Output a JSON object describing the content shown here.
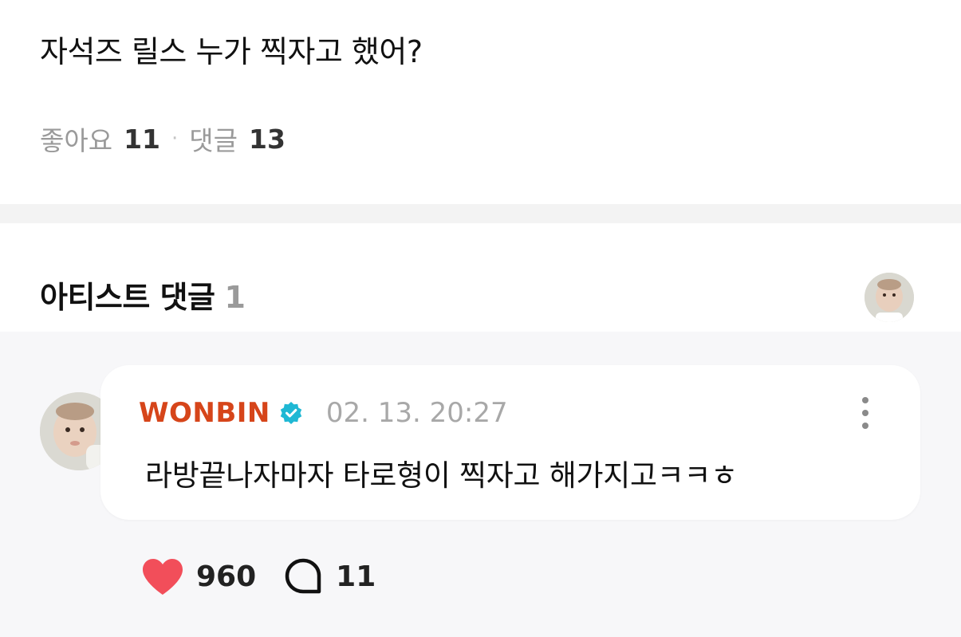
{
  "post": {
    "text": "자석즈 릴스 누가 찍자고 했어?",
    "likes_label": "좋아요",
    "likes_count": "11",
    "separator": "·",
    "comments_label": "댓글",
    "comments_count": "13"
  },
  "artist_section": {
    "title": "아티스트 댓글",
    "count": "1"
  },
  "comment": {
    "author": "WONBIN",
    "author_color": "#d6451a",
    "verified_color": "#1fb8d4",
    "date": "02. 13. 20:27",
    "text": "라방끝나자마자 타로형이 찍자고 해가지고ㅋㅋㅎ",
    "like_count": "960",
    "like_color": "#f24e5a",
    "reply_count": "11"
  }
}
